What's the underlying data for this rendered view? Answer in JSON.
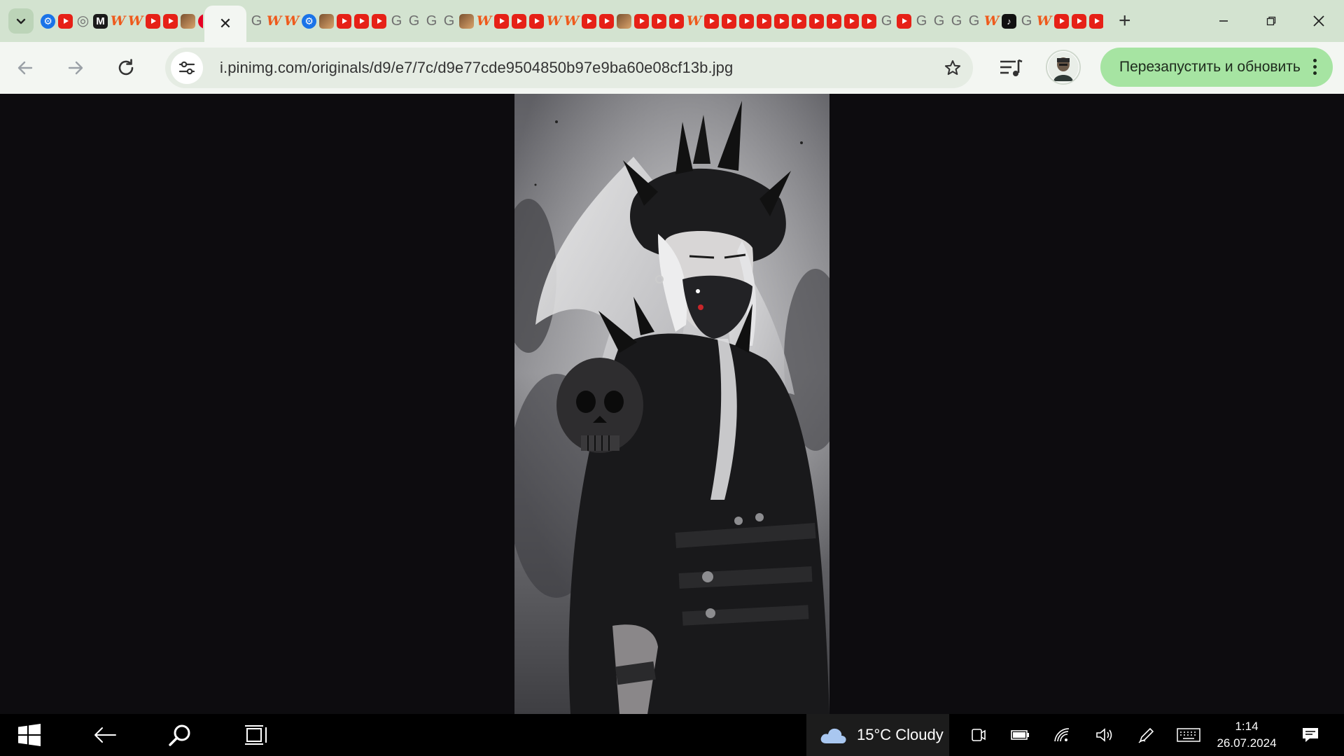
{
  "browser": {
    "active_tab_close": "✕",
    "new_tab": "+",
    "address": "i.pinimg.com/originals/d9/e7/7c/d9e77cde9504850b97e9ba60e08cf13b.jpg",
    "update_button_label": "Перезапустить и обновить",
    "left_favicons": [
      {
        "icon": "settings-favicon",
        "kind": "blue",
        "glyph": "⚙"
      },
      {
        "icon": "youtube-favicon",
        "kind": "yt",
        "glyph": ""
      },
      {
        "icon": "github-favicon",
        "kind": "g",
        "glyph": "◎"
      },
      {
        "icon": "gmail-favicon",
        "kind": "m",
        "glyph": "M"
      },
      {
        "icon": "w-favicon",
        "kind": "w",
        "glyph": "W"
      },
      {
        "icon": "w-favicon",
        "kind": "w",
        "glyph": "W"
      },
      {
        "icon": "youtube-favicon",
        "kind": "yt",
        "glyph": ""
      },
      {
        "icon": "youtube-favicon",
        "kind": "yt",
        "glyph": ""
      },
      {
        "icon": "picture-favicon",
        "kind": "pic",
        "glyph": ""
      },
      {
        "icon": "pinterest-favicon",
        "kind": "p",
        "glyph": "P"
      }
    ],
    "right_favicons_pattern": [
      "g",
      "w",
      "w",
      "blue",
      "pic",
      "yt",
      "yt",
      "yt",
      "g",
      "g",
      "g",
      "g",
      "pic",
      "w",
      "yt",
      "yt",
      "yt",
      "w",
      "w",
      "yt",
      "yt",
      "pic",
      "yt",
      "yt",
      "yt",
      "w",
      "yt",
      "yt",
      "yt",
      "yt",
      "yt",
      "yt",
      "yt",
      "yt",
      "yt",
      "yt",
      "g",
      "yt",
      "g",
      "g",
      "g",
      "g",
      "w",
      "tk",
      "g",
      "w",
      "yt",
      "yt",
      "yt",
      "w",
      "w",
      "vk",
      "yt",
      "g",
      "g",
      "blue",
      "maps",
      "g",
      "yt"
    ]
  },
  "taskbar": {
    "weather": "15°C  Cloudy",
    "time": "1:14",
    "date": "26.07.2024"
  },
  "colors": {
    "tabstrip": "#d3e3d0",
    "toolbar": "#f3f6f2",
    "omnibox": "#e5ece3",
    "update_button": "#a6e4a2",
    "page_background": "#0d0c0f",
    "taskbar": "#000000"
  }
}
